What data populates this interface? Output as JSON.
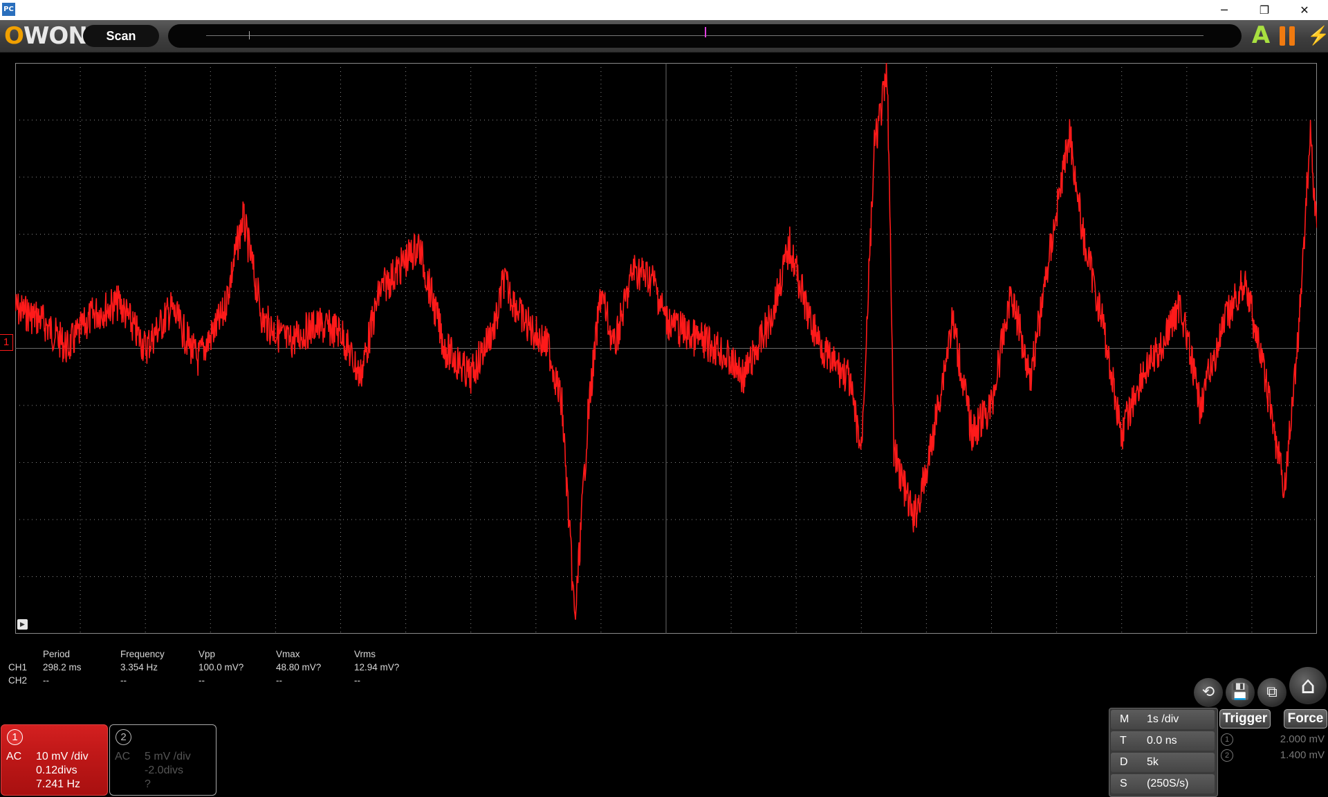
{
  "window": {
    "icon_text": "PC",
    "minimize": "─",
    "restore": "❐",
    "close": "✕"
  },
  "toolbar": {
    "logo_o": "O",
    "logo_rest": "WON",
    "scan_label": "Scan",
    "auto_icon": "A",
    "flash_icon": "⚡"
  },
  "scope": {
    "ch1_marker": "1",
    "trace_color": "#ff1a1a",
    "grid_color": "#8a8a8a"
  },
  "measurements": {
    "headers": [
      "Period",
      "Frequency",
      "Vpp",
      "Vmax",
      "Vrms"
    ],
    "rows": [
      {
        "channel": "CH1",
        "values": [
          "298.2 ms",
          "3.354 Hz",
          "100.0 mV?",
          "48.80 mV?",
          "12.94 mV?"
        ]
      },
      {
        "channel": "CH2",
        "values": [
          "--",
          "--",
          "--",
          "--",
          "--"
        ]
      }
    ]
  },
  "ch1": {
    "number": "1",
    "coupling": "AC",
    "scale": "10 mV /div",
    "offset": "0.12divs",
    "freq": "7.241 Hz"
  },
  "ch2": {
    "number": "2",
    "coupling": "AC",
    "scale": "5 mV /div",
    "offset": "-2.0divs",
    "freq": "?"
  },
  "timebase": [
    {
      "key": "M",
      "value": "1s /div"
    },
    {
      "key": "T",
      "value": "0.0 ns"
    },
    {
      "key": "D",
      "value": "5k"
    },
    {
      "key": "S",
      "value": "(250S/s)"
    }
  ],
  "trigger": {
    "trigger_label": "Trigger",
    "force_label": "Force",
    "levels": [
      {
        "num": "1",
        "value": "2.000 mV"
      },
      {
        "num": "2",
        "value": "1.400 mV"
      }
    ]
  },
  "icons": {
    "home": "⌂",
    "save": "💾",
    "dock": "⧉",
    "reset": "⟲"
  }
}
